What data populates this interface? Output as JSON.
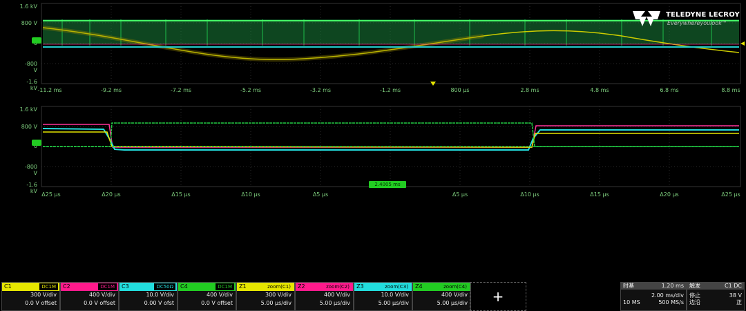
{
  "top_plot": {
    "y_labels": [
      "1.6 kV",
      "800 V",
      "0",
      "-800 V",
      "-1.6 kV"
    ],
    "x_labels": [
      "-11.2 ms",
      "-9.2 ms",
      "-7.2 ms",
      "-5.2 ms",
      "-3.2 ms",
      "-1.2 ms",
      "800 µs",
      "2.8 ms",
      "4.8 ms",
      "6.8 ms",
      "8.8 ms"
    ],
    "ground_marker": "C4"
  },
  "bottom_plot": {
    "y_labels": [
      "1.6 kV",
      "800 V",
      "0",
      "-800 V",
      "-1.6 kV"
    ],
    "x_labels": [
      "Δ25 µs",
      "Δ20 µs",
      "Δ15 µs",
      "Δ10 µs",
      "Δ5 µs",
      "Δ5 µs",
      "Δ10 µs",
      "Δ15 µs",
      "Δ20 µs",
      "Δ25 µs"
    ],
    "zoom_position": "2.4005 ms",
    "ground_marker": "C4"
  },
  "logo": {
    "brand": "TELEDYNE LECROY",
    "tagline": "Everywhereyoulook™"
  },
  "channels": [
    {
      "name": "C1",
      "tag": "DC1M",
      "color": "#e6e600",
      "line1": "300 V/div",
      "line2": "0.0 V offset"
    },
    {
      "name": "C2",
      "tag": "DC1M",
      "color": "#ff1a8c",
      "line1": "400 V/div",
      "line2": "0.0 V offset"
    },
    {
      "name": "C3",
      "tag": "DC50Ω",
      "color": "#22dddd",
      "line1": "10.0 V/div",
      "line2": "0.00 V ofst"
    },
    {
      "name": "C4",
      "tag": "DC1M",
      "color": "#22cc22",
      "line1": "400 V/div",
      "line2": "0.0 V offset"
    }
  ],
  "zooms": [
    {
      "name": "Z1",
      "tag": "zoom(C1)",
      "color": "#e6e600",
      "line1": "300 V/div",
      "line2": "5.00 µs/div"
    },
    {
      "name": "Z2",
      "tag": "zoom(C2)",
      "color": "#ff1a8c",
      "line1": "400 V/div",
      "line2": "5.00 µs/div"
    },
    {
      "name": "Z3",
      "tag": "zoom(C3)",
      "color": "#22dddd",
      "line1": "10.0 V/div",
      "line2": "5.00 µs/div"
    },
    {
      "name": "Z4",
      "tag": "zoom(C4)",
      "color": "#22cc22",
      "line1": "400 V/div",
      "line2": "5.00 µs/div"
    }
  ],
  "add_button": "+",
  "timebase": {
    "label": "时基",
    "delay": "1.20 ms",
    "rate1": "2.00 ms/div",
    "pts": "10 MS",
    "srate": "500 MS/s"
  },
  "trigger": {
    "label": "触发",
    "mode": "停止",
    "level": "38 V",
    "edge": "正",
    "src": "C1 DC",
    "type": "边沿"
  }
}
